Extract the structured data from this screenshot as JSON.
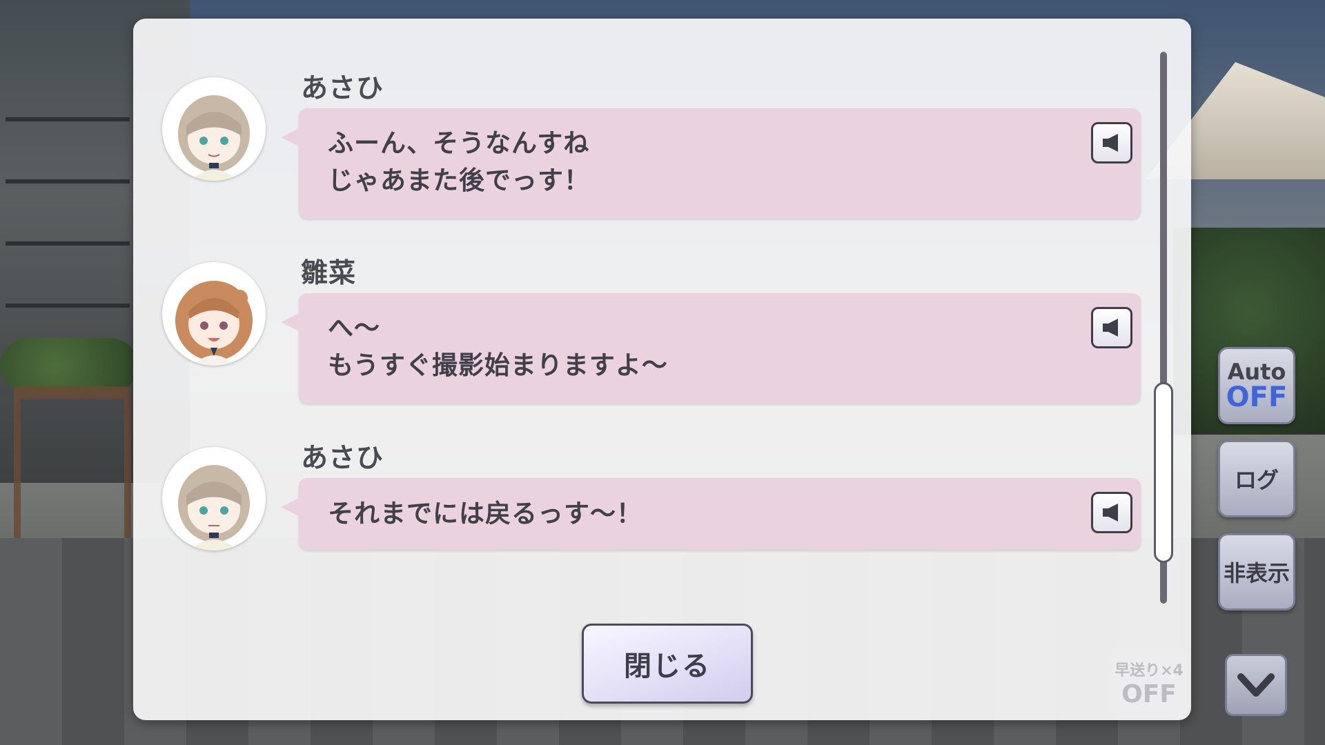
{
  "log": {
    "entries": [
      {
        "speaker": "あさひ",
        "lines": [
          "ふーん、そうなんすね",
          "じゃあまた後でっす！"
        ],
        "avatar_icon": "asahi-avatar-icon"
      },
      {
        "speaker": "雛菜",
        "lines": [
          "へ～",
          "もうすぐ撮影始まりますよ～"
        ],
        "avatar_icon": "hinana-avatar-icon"
      },
      {
        "speaker": "あさひ",
        "lines": [
          "それまでには戻るっす～！"
        ],
        "avatar_icon": "asahi-avatar-icon"
      }
    ],
    "next_entry_speaker": "雛菜",
    "voice_icon": "speaker-play-icon",
    "bubble_color": "#ead2de",
    "close_label": "閉じる"
  },
  "controls": {
    "auto_label": "Auto",
    "auto_state": "OFF",
    "log_label": "ログ",
    "hide_label": "非表示",
    "speed_label": "早送り×4",
    "speed_state": "OFF",
    "down_icon": "chevron-down-icon",
    "accent": "#3f65d8"
  }
}
